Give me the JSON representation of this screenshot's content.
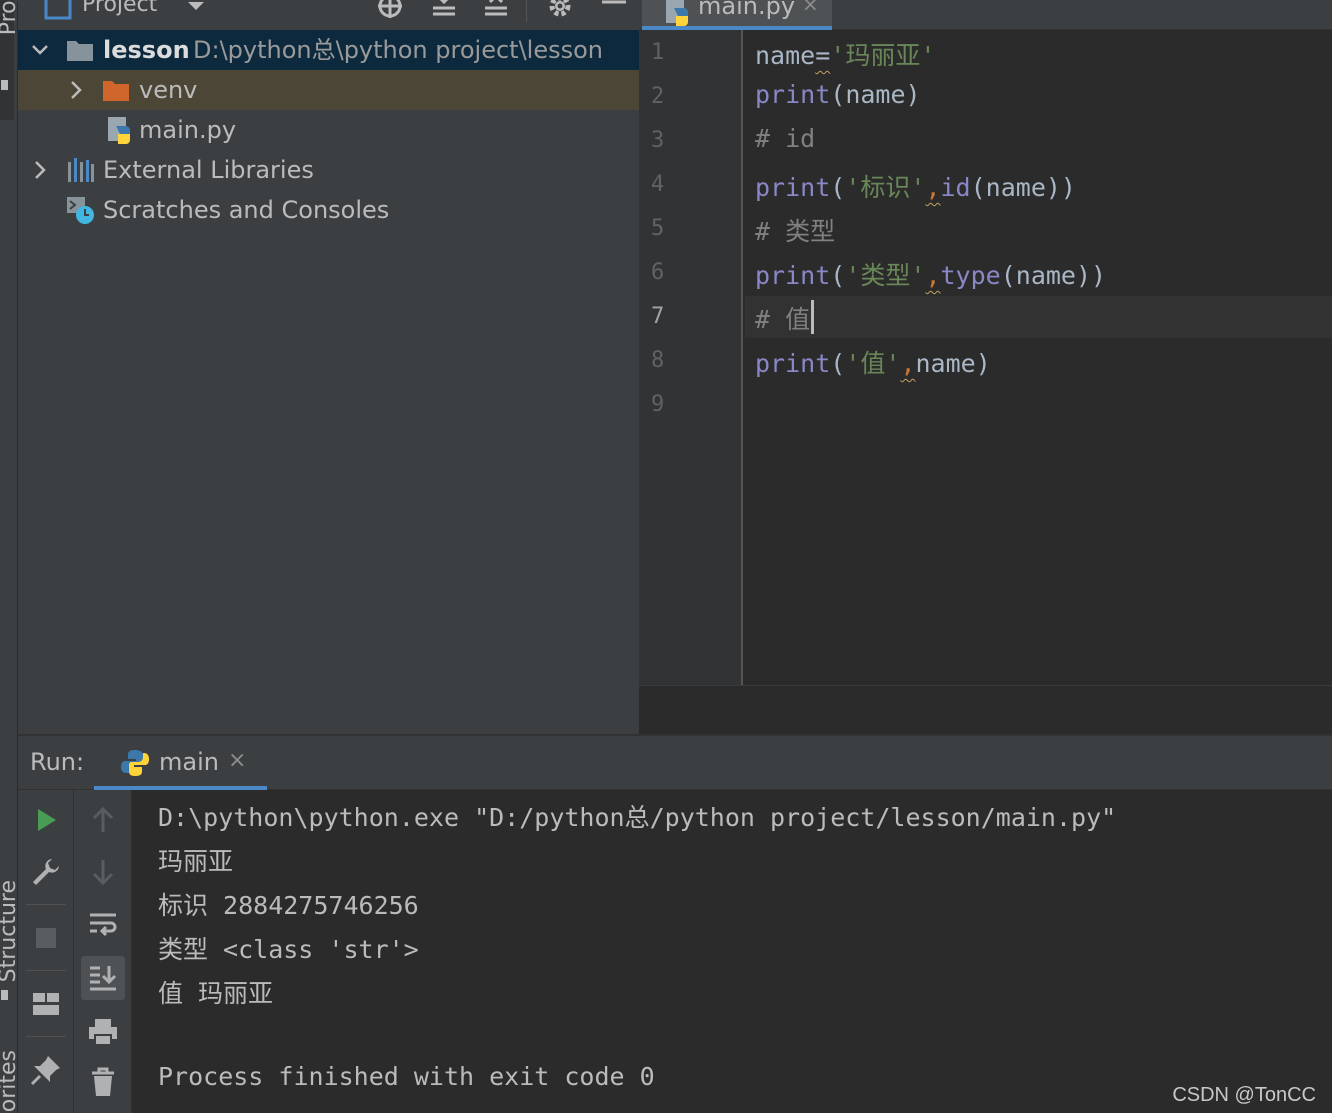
{
  "sidebar": {
    "project_tab": "Project",
    "structure_tab": "Structure",
    "favorites_tab": "Favorites"
  },
  "project_panel": {
    "title": "Project",
    "tree": [
      {
        "name": "lesson",
        "path": "D:\\python总\\python project\\lesson",
        "expanded": true
      },
      {
        "name": "venv",
        "expanded": false
      },
      {
        "name": "main.py"
      },
      {
        "name": "External Libraries",
        "expanded": false
      },
      {
        "name": "Scratches and Consoles"
      }
    ]
  },
  "editor": {
    "tab_label": "main.py",
    "tab_close": "×",
    "line_numbers": [
      "1",
      "2",
      "3",
      "4",
      "5",
      "6",
      "7",
      "8",
      "9"
    ],
    "active_line": "7",
    "lines": {
      "l1": {
        "ident": "name",
        "eq": "=",
        "str": "'玛丽亚'"
      },
      "l2": {
        "fn": "print",
        "open": "(",
        "arg": "name",
        "close": ")"
      },
      "l3": {
        "comment": "# id"
      },
      "l4": {
        "fn": "print",
        "open": "(",
        "str": "'标识'",
        "comma": ",",
        "fn2": "id",
        "rest": "(name))"
      },
      "l5": {
        "comment": "# 类型"
      },
      "l6": {
        "fn": "print",
        "open": "(",
        "str": "'类型'",
        "comma": ",",
        "fn2": "type",
        "rest": "(name))"
      },
      "l7": {
        "comment": "# 值"
      },
      "l8": {
        "fn": "print",
        "open": "(",
        "str": "'值'",
        "comma": ",",
        "rest": "name)"
      }
    }
  },
  "run_panel": {
    "label": "Run:",
    "tab_label": "main",
    "tab_close": "×",
    "output": [
      "D:\\python\\python.exe \"D:/python总/python project/lesson/main.py\"",
      "玛丽亚",
      "标识 2884275746256",
      "类型 <class 'str'>",
      "值 玛丽亚",
      "",
      "Process finished with exit code 0"
    ]
  },
  "watermark": "CSDN @TonCC",
  "colors": {
    "keyword_builtin": "#8888c6",
    "string": "#6a8759",
    "comment": "#808080",
    "selection": "#0d293e",
    "accent": "#4a88c7"
  }
}
